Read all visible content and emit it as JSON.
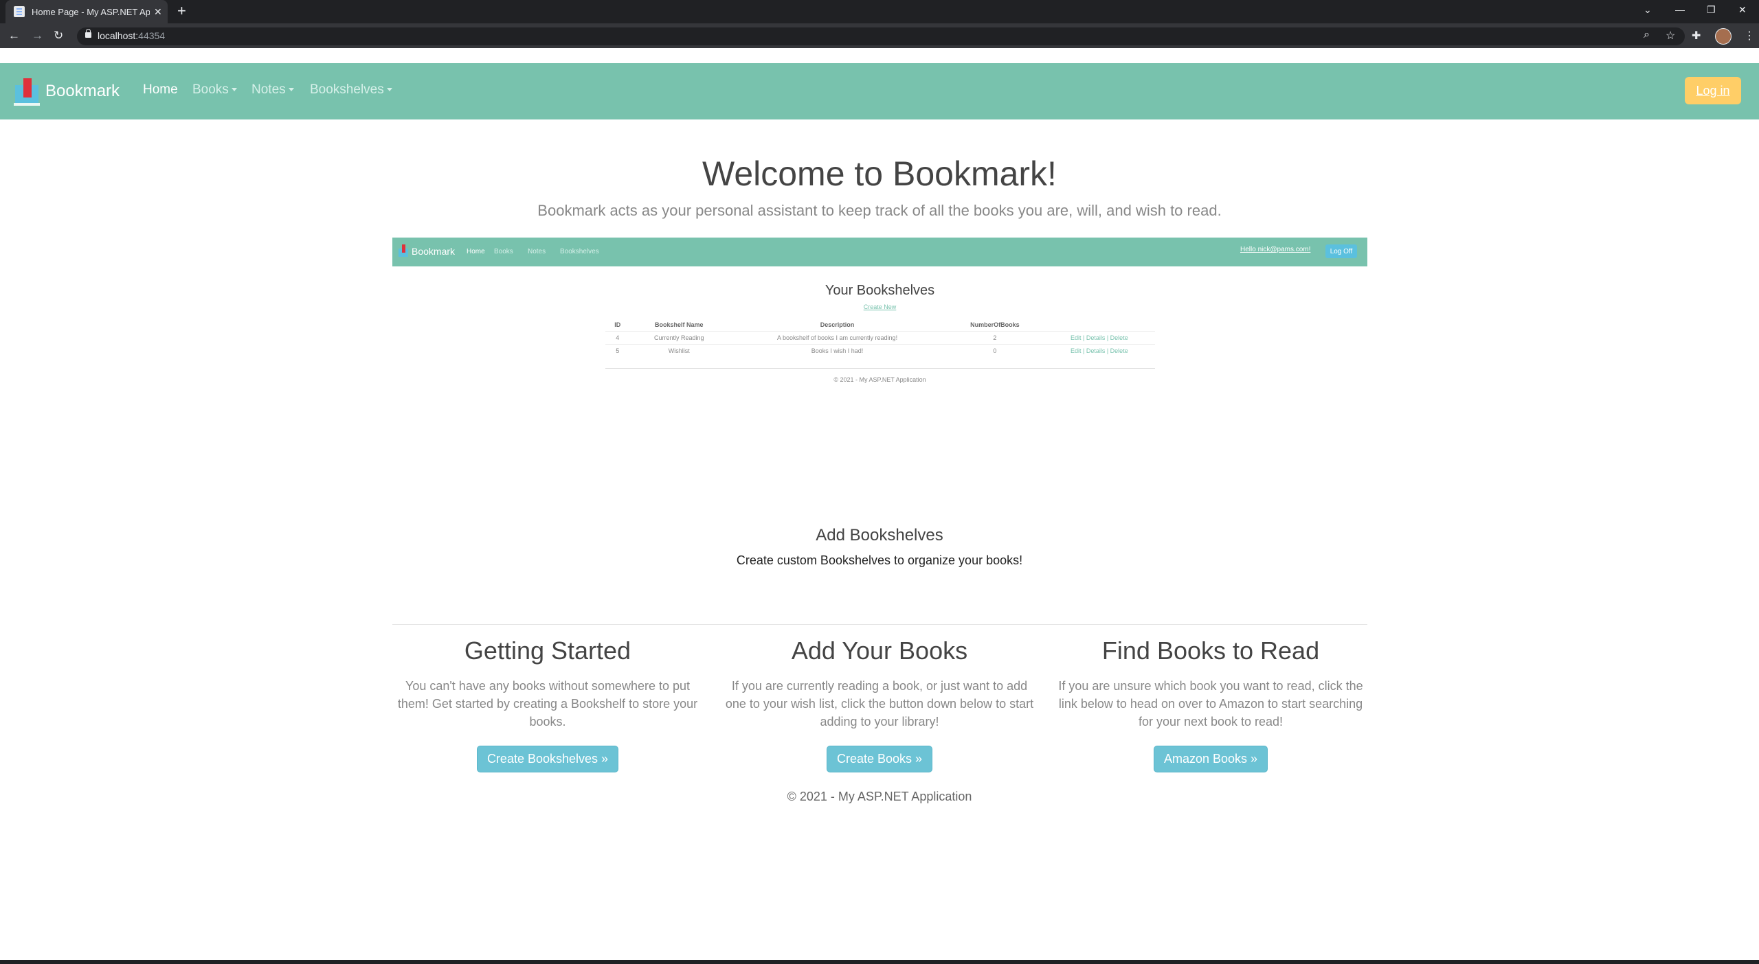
{
  "browser": {
    "tab_title": "Home Page - My ASP.NET Applic",
    "tab_close": "✕",
    "new_tab": "+",
    "url_host": "localhost:",
    "url_port": "44354",
    "back": "←",
    "forward": "→",
    "reload": "↻",
    "zoom_icon": "⌕",
    "star_icon": "☆",
    "ext_icon": "✚",
    "menu_icon": "⋮",
    "win_dropdown": "⌄",
    "win_min": "—",
    "win_restore": "❐",
    "win_close": "✕"
  },
  "navbar": {
    "brand": "Bookmark",
    "home": "Home",
    "books": "Books",
    "notes": "Notes",
    "bookshelves": "Bookshelves",
    "login": "Log in"
  },
  "hero": {
    "title": "Welcome to Bookmark!",
    "subtitle": "Bookmark acts as your personal assistant to keep track of all the books you are, will, and wish to read."
  },
  "preview": {
    "brand": "Bookmark",
    "nav": [
      "Home",
      "Books",
      "Notes",
      "Bookshelves"
    ],
    "hello": "Hello nick@pams.com!",
    "logoff": "Log Off",
    "heading": "Your Bookshelves",
    "create_new": "Create New",
    "columns": [
      "ID",
      "Bookshelf Name",
      "Description",
      "NumberOfBooks",
      ""
    ],
    "rows": [
      {
        "id": "4",
        "name": "Currently Reading",
        "description": "A bookshelf of books I am currently reading!",
        "count": "2",
        "actions": "Edit | Details | Delete"
      },
      {
        "id": "5",
        "name": "Wishlist",
        "description": "Books I wish I had!",
        "count": "0",
        "actions": "Edit | Details | Delete"
      }
    ],
    "footer": "© 2021 - My ASP.NET Application"
  },
  "caption": {
    "title": "Add Bookshelves",
    "text": "Create custom Bookshelves to organize your books!"
  },
  "columns": [
    {
      "title": "Getting Started",
      "text": "You can't have any books without somewhere to put them! Get started by creating a Bookshelf to store your books.",
      "button": "Create Bookshelves »"
    },
    {
      "title": "Add Your Books",
      "text": "If you are currently reading a book, or just want to add one to your wish list, click the button down below to start adding to your library!",
      "button": "Create Books »"
    },
    {
      "title": "Find Books to Read",
      "text": "If you are unsure which book you want to read, click the link below to head on over to Amazon to start searching for your next book to read!",
      "button": "Amazon Books »"
    }
  ],
  "footer": "© 2021 - My ASP.NET Application",
  "colors": {
    "primary": "#78c2ad",
    "warning": "#ffce67",
    "info": "#6cc3d5"
  }
}
